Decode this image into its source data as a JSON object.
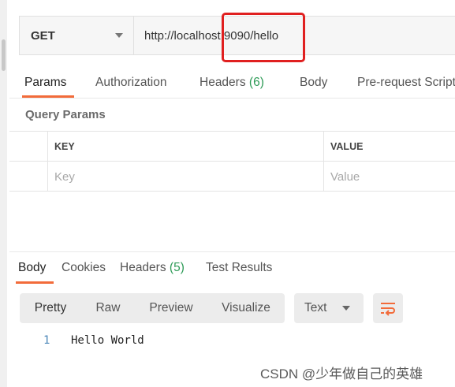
{
  "request": {
    "method": "GET",
    "url": "http://localhost:9090/hello"
  },
  "request_tabs": [
    {
      "label": "Params",
      "count": ""
    },
    {
      "label": "Authorization",
      "count": ""
    },
    {
      "label": "Headers",
      "count": "(6)"
    },
    {
      "label": "Body",
      "count": ""
    },
    {
      "label": "Pre-request Script",
      "count": ""
    }
  ],
  "query_params": {
    "title": "Query Params",
    "headers": {
      "key": "KEY",
      "value": "VALUE"
    },
    "placeholders": {
      "key": "Key",
      "value": "Value"
    }
  },
  "response_tabs": [
    {
      "label": "Body",
      "count": ""
    },
    {
      "label": "Cookies",
      "count": ""
    },
    {
      "label": "Headers",
      "count": "(5)"
    },
    {
      "label": "Test Results",
      "count": ""
    }
  ],
  "format_buttons": [
    "Pretty",
    "Raw",
    "Preview",
    "Visualize"
  ],
  "format_type": "Text",
  "response_body": {
    "line_number": "1",
    "text": "Hello World"
  },
  "watermark": "CSDN @少年做自己的英雄",
  "colors": {
    "accent": "#f26b3a",
    "count_green": "#2e9b57",
    "highlight_red": "#e02020"
  },
  "icons": {
    "method_dropdown": "chevron-down-icon",
    "type_dropdown": "chevron-down-icon",
    "wrap": "wrap-lines-icon"
  }
}
